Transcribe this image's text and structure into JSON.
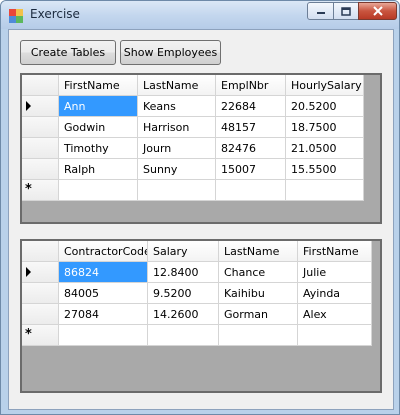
{
  "window": {
    "title": "Exercise"
  },
  "toolbar": {
    "create_tables_label": "Create Tables",
    "show_employees_label": "Show Employees"
  },
  "employees_grid": {
    "columns": [
      "FirstName",
      "LastName",
      "EmplNbr",
      "HourlySalary"
    ],
    "rows": [
      [
        "Ann",
        "Keans",
        "22684",
        "20.5200"
      ],
      [
        "Godwin",
        "Harrison",
        "48157",
        "18.7500"
      ],
      [
        "Timothy",
        "Journ",
        "82476",
        "21.0500"
      ],
      [
        "Ralph",
        "Sunny",
        "15007",
        "15.5500"
      ]
    ],
    "new_row_marker": "*"
  },
  "contractors_grid": {
    "columns": [
      "ContractorCode",
      "Salary",
      "LastName",
      "FirstName"
    ],
    "rows": [
      [
        "86824",
        "12.8400",
        "Chance",
        "Julie"
      ],
      [
        "84005",
        "9.5200",
        "Kaihibu",
        "Ayinda"
      ],
      [
        "27084",
        "14.2600",
        "Gorman",
        "Alex"
      ]
    ],
    "new_row_marker": "*"
  },
  "colors": {
    "selection": "#3399ff",
    "grid_background": "#a9a9a9",
    "close_button": "#c9553f"
  }
}
